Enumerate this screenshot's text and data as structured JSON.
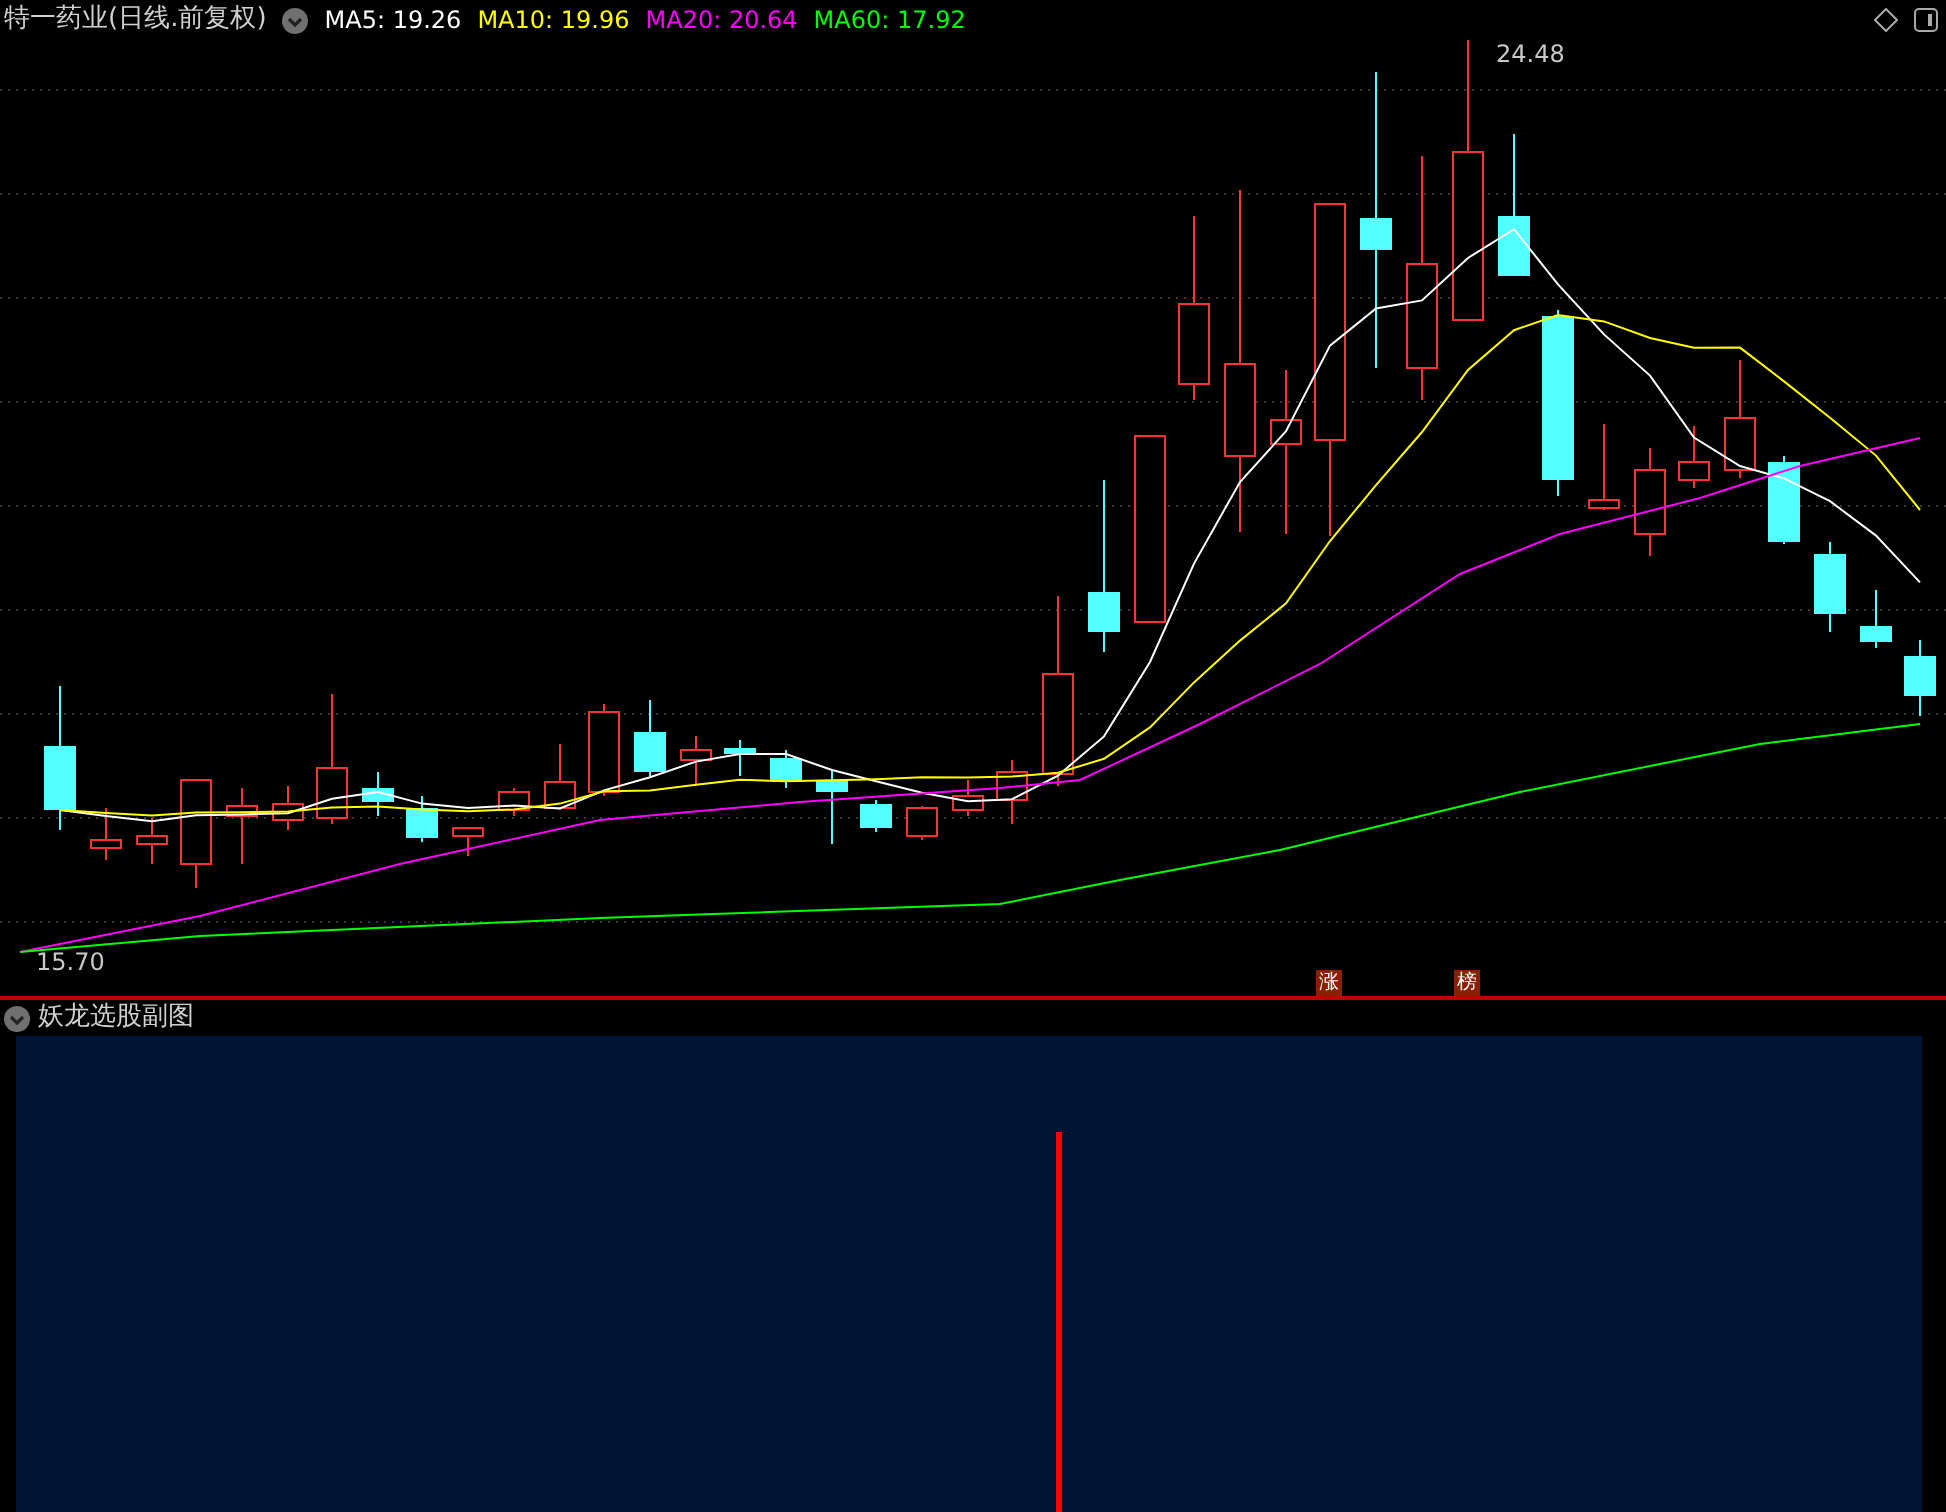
{
  "header": {
    "title": "特一药业(日线.前复权)",
    "indicators": [
      {
        "text": "MA5: 19.26",
        "color": "#ffffff"
      },
      {
        "text": "MA10: 19.96",
        "color": "#ffff00"
      },
      {
        "text": "MA20: 20.64",
        "color": "#ff00ff"
      },
      {
        "text": "MA60: 17.92",
        "color": "#00ff00"
      }
    ]
  },
  "chart": {
    "high_label": "24.48",
    "low_label": "15.70",
    "markers": [
      "涨",
      "榜"
    ]
  },
  "subchart": {
    "title": "妖龙选股副图"
  }
}
